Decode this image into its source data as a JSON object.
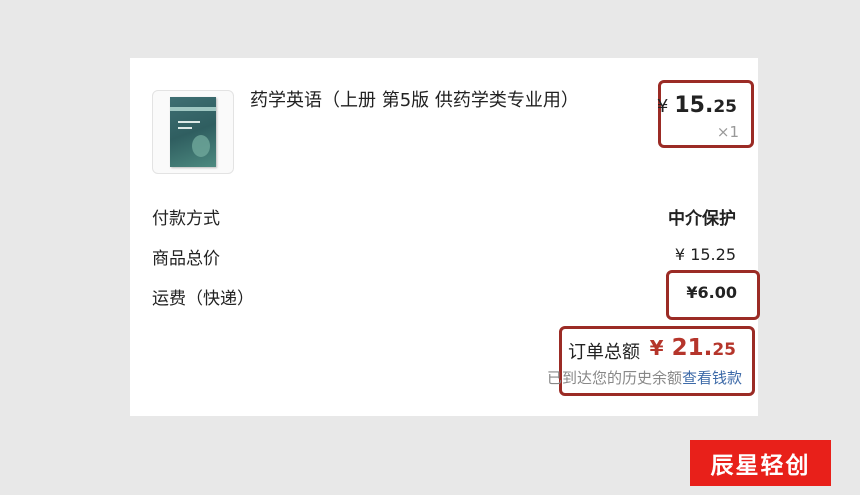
{
  "item": {
    "title": "药学英语（上册 第5版 供药学类专业用）",
    "price_currency": "¥",
    "price_int": "15.",
    "price_dec": "25",
    "quantity": "×1",
    "cover_icon": "book-cover-image"
  },
  "rows": {
    "payment_label": "付款方式",
    "payment_value": "中介保护",
    "goods_label": "商品总价",
    "goods_value": "¥ 15.25",
    "shipping_label": "运费（快递）",
    "shipping_value": "¥6.00"
  },
  "total": {
    "label": "订单总额",
    "currency": "¥",
    "amount_int": "21.",
    "amount_dec": "25",
    "hint_text": "已到达您的历史余额",
    "hint_link": "查看钱款"
  },
  "watermark": "辰星轻创",
  "colors": {
    "highlight_border": "#9b2b25",
    "total_amount": "#b5352b",
    "link": "#3d6aa8",
    "watermark_bg": "#e8201a"
  }
}
